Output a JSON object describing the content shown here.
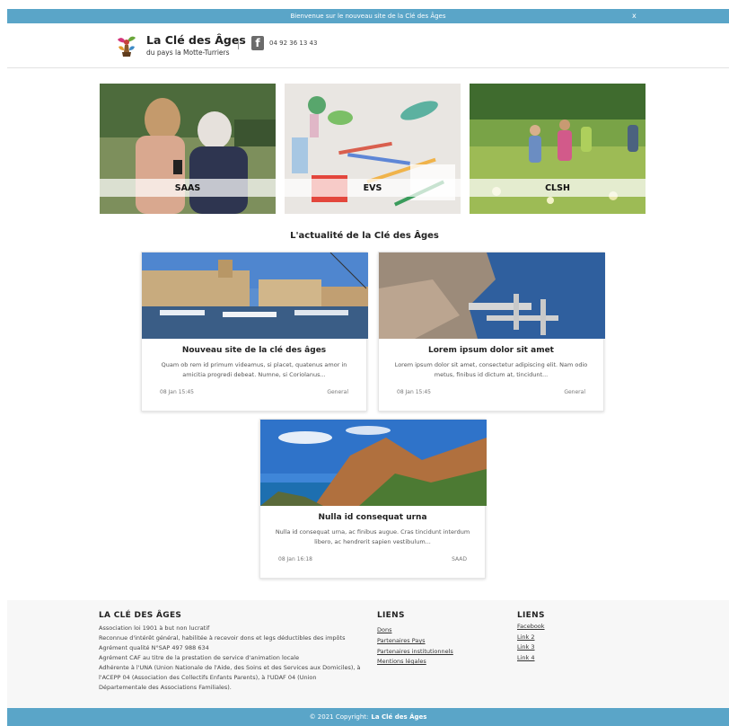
{
  "announcement": {
    "text": "Bienvenue sur le nouveau site de la Clé des Âges",
    "close": "x"
  },
  "header": {
    "title": "La Clé des Âges",
    "subtitle": "du pays la Motte-Turriers",
    "phone": "04 92 36 13 43"
  },
  "services": [
    {
      "label": "SAAS"
    },
    {
      "label": "EVS"
    },
    {
      "label": "CLSH"
    }
  ],
  "news": {
    "heading": "L'actualité de la Clé des Âges",
    "posts": [
      {
        "title": "Nouveau site de la clé des âges",
        "excerpt": "Quam ob rem id primum videamus, si placet, quatenus amor in amicitia progredi debeat. Numne, si Coriolanus...",
        "date": "08 Jan 15:45",
        "category": "General"
      },
      {
        "title": "Lorem ipsum dolor sit amet",
        "excerpt": "Lorem ipsum dolor sit amet, consectetur adipiscing elit. Nam odio metus, finibus id dictum at, tincidunt...",
        "date": "08 Jan 15:45",
        "category": "General"
      },
      {
        "title": "Nulla id consequat urna",
        "excerpt": "Nulla id consequat urna, ac finibus augue. Cras tincidunt interdum libero, ac hendrerit sapien vestibulum...",
        "date": "08 Jan 16:18",
        "category": "SAAD"
      }
    ]
  },
  "footer": {
    "about": {
      "title": "LA CLÉ DES ÂGES",
      "lines": [
        "Association loi 1901 à but non lucratif",
        "Reconnue d'intérêt général, habilitée à recevoir dons et legs déductibles des impôts",
        "Agrément qualité N°SAP 497 988 634",
        "Agrément CAF au titre de la prestation de service d'animation locale",
        "Adhérente à l'UNA (Union Nationale de l'Aide, des Soins et des Services aux Domiciles), à",
        "l'ACEPP 04 (Association des Collectifs Enfants Parents), à l'UDAF 04 (Union",
        "Départementale des Associations Familiales)."
      ]
    },
    "links1": {
      "title": "LIENS",
      "items": [
        "Dons",
        "Partenaires Pays",
        "Partenaires institutionnels",
        "Mentions légales"
      ]
    },
    "links2": {
      "title": "LIENS",
      "items": [
        "Facebook",
        "Link 2",
        "Link 3",
        "Link 4"
      ]
    }
  },
  "copyright": {
    "prefix": "© 2021 Copyright:",
    "brand": "La Clé des Âges"
  },
  "colors": {
    "accent": "#5aa5c8",
    "footer_bg": "#f7f7f7"
  }
}
